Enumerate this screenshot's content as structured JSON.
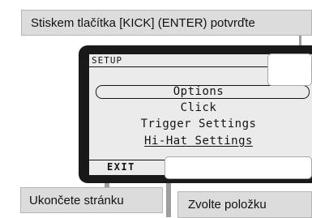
{
  "callouts": {
    "confirm": "Stiskem tlačítka [KICK] (ENTER) potvrďte",
    "exit": "Ukončete stránku",
    "select": "Zvolte položku"
  },
  "lcd": {
    "title": "SETUP",
    "menu": [
      "Options",
      "Click",
      "Trigger Settings",
      "Hi-Hat Settings"
    ],
    "selected": "Options",
    "exit_label": "EXIT"
  },
  "colors": {
    "callout_bg": "#dcdcdc",
    "lcd_frame": "#191919",
    "lcd_screen": "#ebebeb"
  }
}
